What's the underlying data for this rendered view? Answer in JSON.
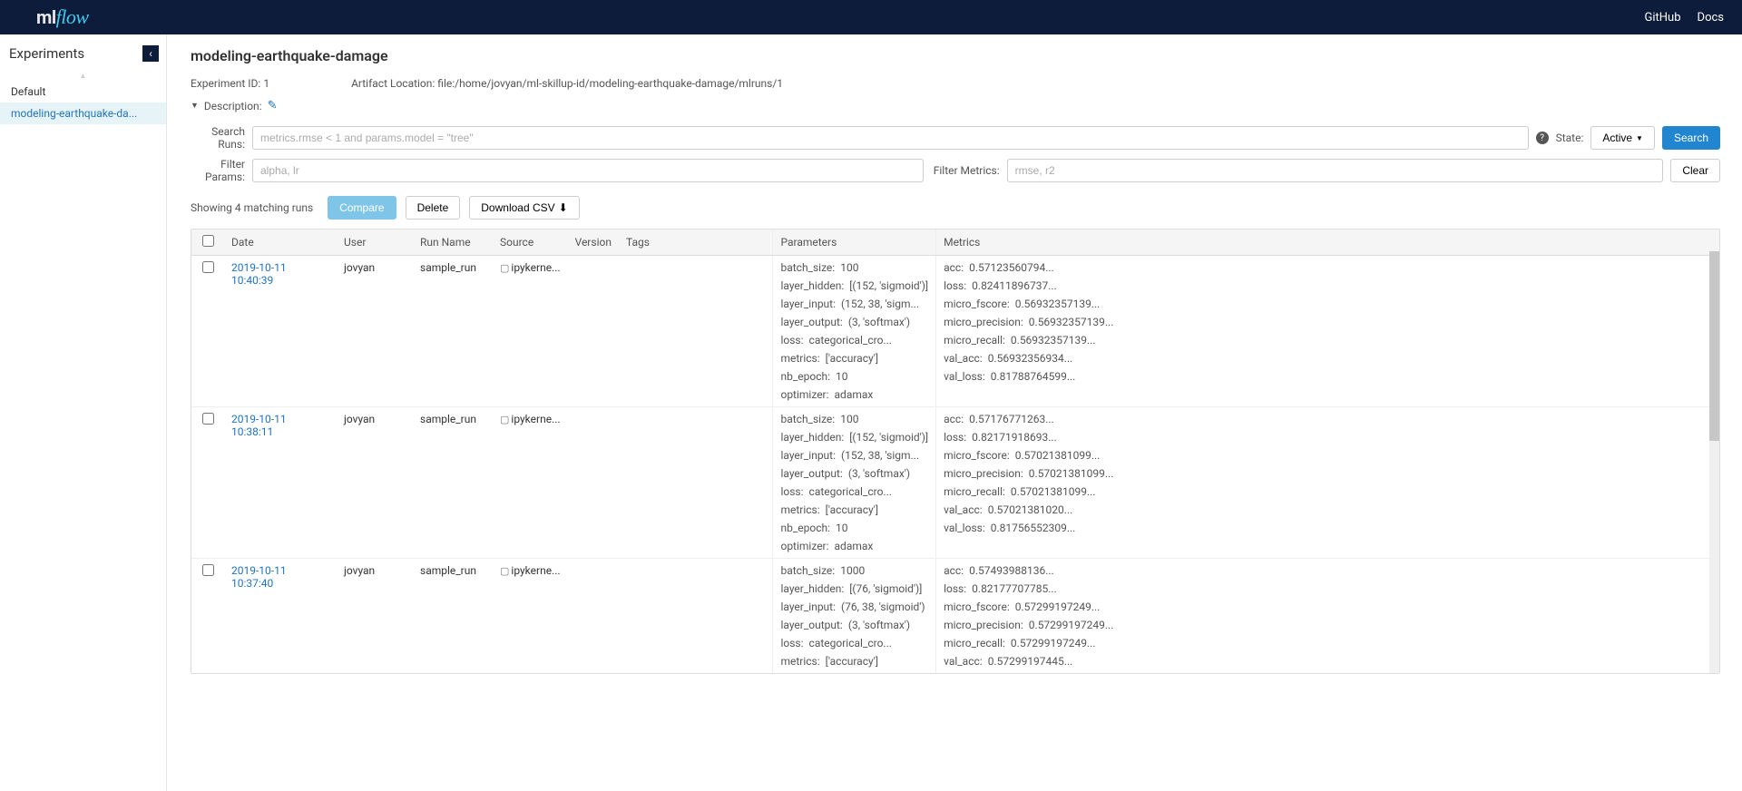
{
  "header": {
    "logo_ml": "ml",
    "logo_flow": "flow",
    "links": {
      "github": "GitHub",
      "docs": "Docs"
    }
  },
  "sidebar": {
    "title": "Experiments",
    "items": [
      {
        "label": "Default",
        "active": false
      },
      {
        "label": "modeling-earthquake-da...",
        "active": true
      }
    ]
  },
  "page": {
    "title": "modeling-earthquake-damage",
    "experiment_id_label": "Experiment ID:",
    "experiment_id": "1",
    "artifact_label": "Artifact Location:",
    "artifact_location": "file:/home/jovyan/ml-skillup-id/modeling-earthquake-damage/mlruns/1",
    "description_label": "Description:"
  },
  "search": {
    "runs_label": "Search Runs:",
    "runs_placeholder": "metrics.rmse < 1 and params.model = \"tree\"",
    "state_label": "State:",
    "active_button": "Active",
    "search_button": "Search",
    "filter_params_label": "Filter Params:",
    "filter_params_placeholder": "alpha, lr",
    "filter_metrics_label": "Filter Metrics:",
    "filter_metrics_placeholder": "rmse, r2",
    "clear_button": "Clear"
  },
  "actions": {
    "matching_text": "Showing 4 matching runs",
    "compare": "Compare",
    "delete": "Delete",
    "download_csv": "Download CSV"
  },
  "columns": {
    "date": "Date",
    "user": "User",
    "run_name": "Run Name",
    "source": "Source",
    "version": "Version",
    "tags": "Tags",
    "parameters": "Parameters",
    "metrics": "Metrics"
  },
  "runs": [
    {
      "date": "2019-10-11 10:40:39",
      "user": "jovyan",
      "run_name": "sample_run",
      "source": "ipykerne...",
      "parameters": [
        {
          "k": "batch_size:",
          "v": "100"
        },
        {
          "k": "layer_hidden:",
          "v": "[(152, 'sigmoid')]"
        },
        {
          "k": "layer_input:",
          "v": "(152, 38, 'sigm..."
        },
        {
          "k": "layer_output:",
          "v": "(3, 'softmax')"
        },
        {
          "k": "loss:",
          "v": "categorical_cro..."
        },
        {
          "k": "metrics:",
          "v": "['accuracy']"
        },
        {
          "k": "nb_epoch:",
          "v": "10"
        },
        {
          "k": "optimizer:",
          "v": "adamax"
        }
      ],
      "metrics": [
        {
          "k": "acc:",
          "v": "0.57123560794..."
        },
        {
          "k": "loss:",
          "v": "0.82411896737..."
        },
        {
          "k": "micro_fscore:",
          "v": "0.56932357139..."
        },
        {
          "k": "micro_precision:",
          "v": "0.56932357139..."
        },
        {
          "k": "micro_recall:",
          "v": "0.56932357139..."
        },
        {
          "k": "val_acc:",
          "v": "0.56932356934..."
        },
        {
          "k": "val_loss:",
          "v": "0.81788764599..."
        }
      ]
    },
    {
      "date": "2019-10-11 10:38:11",
      "user": "jovyan",
      "run_name": "sample_run",
      "source": "ipykerne...",
      "parameters": [
        {
          "k": "batch_size:",
          "v": "100"
        },
        {
          "k": "layer_hidden:",
          "v": "[(152, 'sigmoid')]"
        },
        {
          "k": "layer_input:",
          "v": "(152, 38, 'sigm..."
        },
        {
          "k": "layer_output:",
          "v": "(3, 'softmax')"
        },
        {
          "k": "loss:",
          "v": "categorical_cro..."
        },
        {
          "k": "metrics:",
          "v": "['accuracy']"
        },
        {
          "k": "nb_epoch:",
          "v": "10"
        },
        {
          "k": "optimizer:",
          "v": "adamax"
        }
      ],
      "metrics": [
        {
          "k": "acc:",
          "v": "0.57176771263..."
        },
        {
          "k": "loss:",
          "v": "0.82171918693..."
        },
        {
          "k": "micro_fscore:",
          "v": "0.57021381099..."
        },
        {
          "k": "micro_precision:",
          "v": "0.57021381099..."
        },
        {
          "k": "micro_recall:",
          "v": "0.57021381099..."
        },
        {
          "k": "val_acc:",
          "v": "0.57021381020..."
        },
        {
          "k": "val_loss:",
          "v": "0.81756552309..."
        }
      ]
    },
    {
      "date": "2019-10-11 10:37:40",
      "user": "jovyan",
      "run_name": "sample_run",
      "source": "ipykerne...",
      "parameters": [
        {
          "k": "batch_size:",
          "v": "1000"
        },
        {
          "k": "layer_hidden:",
          "v": "[(76, 'sigmoid')]"
        },
        {
          "k": "layer_input:",
          "v": "(76, 38, 'sigmoid')"
        },
        {
          "k": "layer_output:",
          "v": "(3, 'softmax')"
        },
        {
          "k": "loss:",
          "v": "categorical_cro..."
        },
        {
          "k": "metrics:",
          "v": "['accuracy']"
        }
      ],
      "metrics": [
        {
          "k": "acc:",
          "v": "0.57493988136..."
        },
        {
          "k": "loss:",
          "v": "0.82177707785..."
        },
        {
          "k": "micro_fscore:",
          "v": "0.57299197249..."
        },
        {
          "k": "micro_precision:",
          "v": "0.57299197249..."
        },
        {
          "k": "micro_recall:",
          "v": "0.57299197249..."
        },
        {
          "k": "val_acc:",
          "v": "0.57299197445..."
        }
      ]
    }
  ]
}
